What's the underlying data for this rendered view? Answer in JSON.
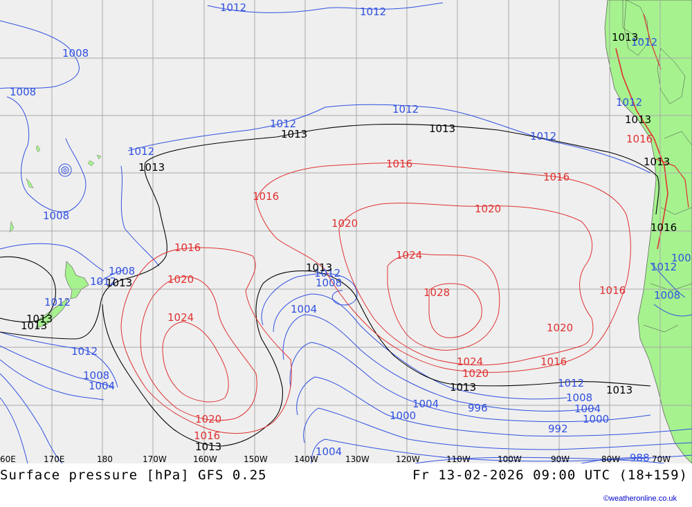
{
  "footer": {
    "title": "Surface pressure [hPa] GFS 0.25",
    "datetime": "Fr 13-02-2026 09:00 UTC (18+159)",
    "credit": "©weatheronline.co.uk"
  },
  "colors": {
    "background": "#efefef",
    "land": "#a6f28f",
    "grid": "#a8a8a8",
    "isobar_low": "#3050e0",
    "isobar_high": "#e03030",
    "isobar_ref": "#000000"
  },
  "longitude_ticks": [
    "60E",
    "170E",
    "180",
    "170W",
    "160W",
    "150W",
    "140W",
    "130W",
    "120W",
    "110W",
    "100W",
    "90W",
    "80W",
    "70W"
  ],
  "isobar_labels": [
    {
      "text": "1012",
      "color": "blue"
    },
    {
      "text": "1012",
      "color": "blue"
    },
    {
      "text": "1008",
      "color": "blue"
    },
    {
      "text": "1008",
      "color": "blue"
    },
    {
      "text": "1012",
      "color": "blue"
    },
    {
      "text": "1012",
      "color": "blue"
    },
    {
      "text": "1012",
      "color": "blue"
    },
    {
      "text": "1012",
      "color": "blue"
    },
    {
      "text": "1008",
      "color": "blue"
    },
    {
      "text": "1008",
      "color": "blue"
    },
    {
      "text": "1012",
      "color": "blue"
    },
    {
      "text": "1008",
      "color": "blue"
    },
    {
      "text": "1004",
      "color": "blue"
    },
    {
      "text": "1012",
      "color": "blue"
    },
    {
      "text": "1012",
      "color": "blue"
    },
    {
      "text": "1008",
      "color": "blue"
    },
    {
      "text": "1004",
      "color": "blue"
    },
    {
      "text": "996",
      "color": "blue"
    },
    {
      "text": "1004",
      "color": "blue"
    },
    {
      "text": "1000",
      "color": "blue"
    },
    {
      "text": "1004",
      "color": "blue"
    },
    {
      "text": "1000",
      "color": "blue"
    },
    {
      "text": "992",
      "color": "blue"
    },
    {
      "text": "988",
      "color": "blue"
    },
    {
      "text": "1008",
      "color": "blue"
    },
    {
      "text": "1004",
      "color": "blue"
    },
    {
      "text": "1012",
      "color": "blue"
    },
    {
      "text": "1012",
      "color": "blue"
    },
    {
      "text": "1012",
      "color": "blue"
    },
    {
      "text": "1012",
      "color": "blue"
    },
    {
      "text": "1008",
      "color": "blue"
    },
    {
      "text": "1008",
      "color": "blue"
    },
    {
      "text": "1012",
      "color": "blue"
    },
    {
      "text": "1013",
      "color": "black"
    },
    {
      "text": "1013",
      "color": "black"
    },
    {
      "text": "1013",
      "color": "black"
    },
    {
      "text": "1013",
      "color": "black"
    },
    {
      "text": "1013",
      "color": "black"
    },
    {
      "text": "1013",
      "color": "black"
    },
    {
      "text": "1013",
      "color": "black"
    },
    {
      "text": "1013",
      "color": "black"
    },
    {
      "text": "1013",
      "color": "black"
    },
    {
      "text": "1013",
      "color": "black"
    },
    {
      "text": "1013",
      "color": "black"
    },
    {
      "text": "1013",
      "color": "black"
    },
    {
      "text": "1013",
      "color": "black"
    },
    {
      "text": "1016",
      "color": "red"
    },
    {
      "text": "1016",
      "color": "red"
    },
    {
      "text": "1016",
      "color": "red"
    },
    {
      "text": "1016",
      "color": "red"
    },
    {
      "text": "1016",
      "color": "red"
    },
    {
      "text": "1016",
      "color": "red"
    },
    {
      "text": "1016",
      "color": "red"
    },
    {
      "text": "1016",
      "color": "red"
    },
    {
      "text": "1020",
      "color": "red"
    },
    {
      "text": "1020",
      "color": "red"
    },
    {
      "text": "1020",
      "color": "red"
    },
    {
      "text": "1020",
      "color": "red"
    },
    {
      "text": "1020",
      "color": "red"
    },
    {
      "text": "1024",
      "color": "red"
    },
    {
      "text": "1024",
      "color": "red"
    },
    {
      "text": "1024",
      "color": "red"
    },
    {
      "text": "1028",
      "color": "red"
    }
  ]
}
